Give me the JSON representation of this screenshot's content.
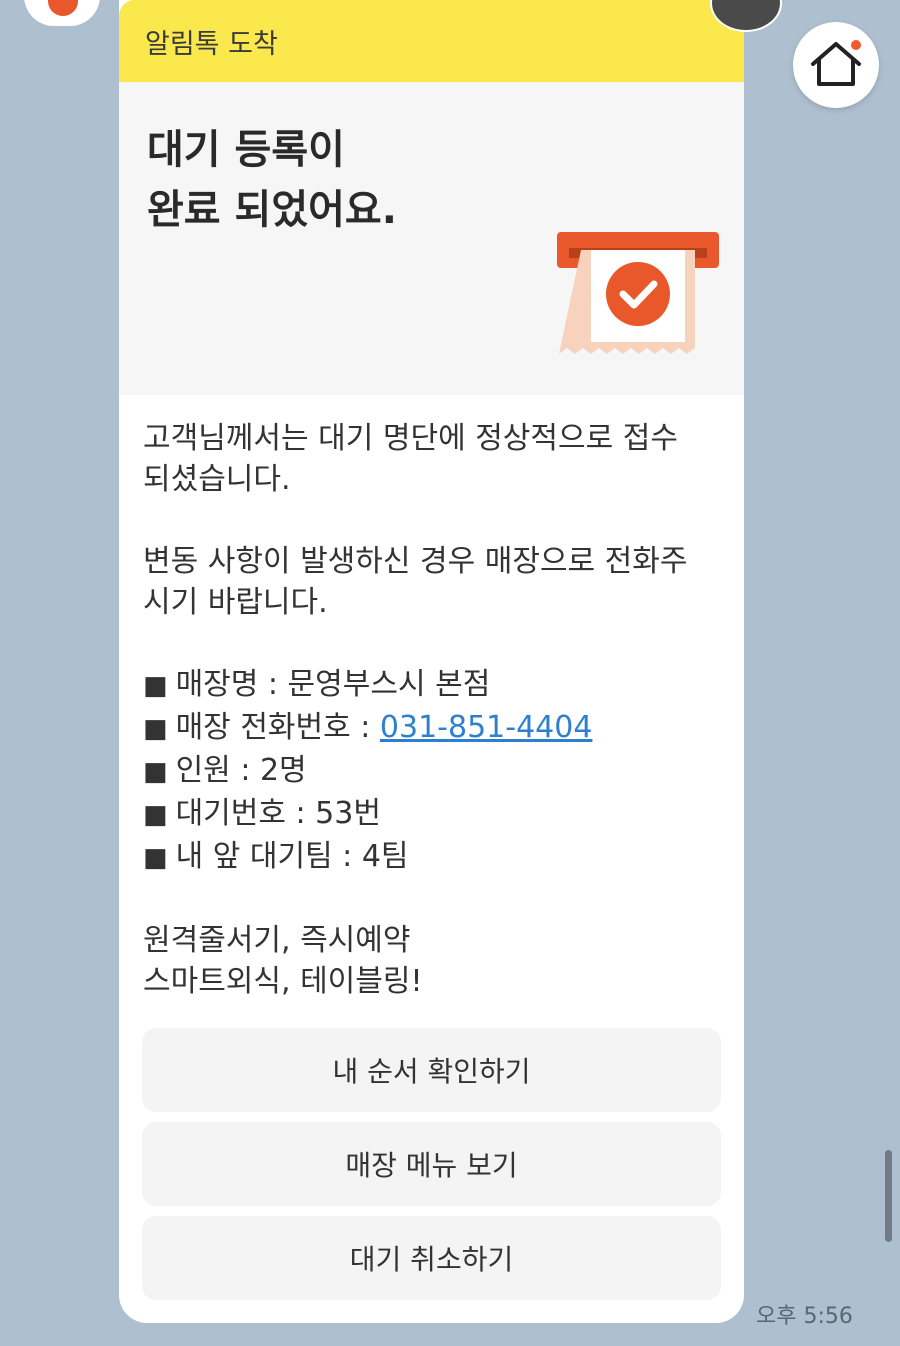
{
  "header": {
    "label": "알림톡 도착"
  },
  "hero": {
    "title_line1": "대기 등록이",
    "title_line2": "완료 되었어요.",
    "icon": "receipt-check-icon"
  },
  "message": {
    "para1_line1": "고객님께서는 대기 명단에 정상적으로 접수",
    "para1_line2": "되셨습니다.",
    "para2_line1": "변동 사항이 발생하신 경우 매장으로 전화주",
    "para2_line2": "시기 바랍니다.",
    "store_name_label": "매장명 : 문영부스시 본점",
    "store_phone_label": "매장 전화번호 : ",
    "store_phone": "031-851-4404",
    "party_size": "인원 : 2명",
    "waiting_number": "대기번호 : 53번",
    "teams_ahead": "내 앞 대기팀 : 4팀",
    "bullet": "■",
    "promo_line1": "원격줄서기, 즉시예약",
    "promo_line2": "스마트외식, 테이블링!"
  },
  "buttons": {
    "check_order": "내 순서 확인하기",
    "view_menu": "매장 메뉴 보기",
    "cancel_wait": "대기 취소하기"
  },
  "timestamp": "오후 5:56",
  "colors": {
    "background": "#aebfcf",
    "header_yellow": "#fae84c",
    "accent_orange": "#e8582a",
    "link_blue": "#2f7fd0"
  }
}
